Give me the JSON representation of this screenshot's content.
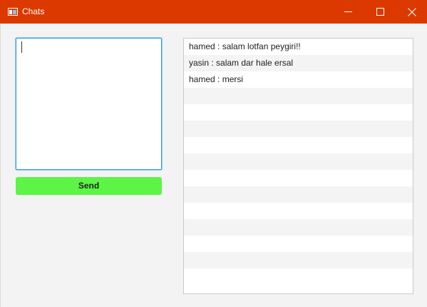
{
  "window": {
    "title": "Chats",
    "accent_color": "#dc3900",
    "icons": {
      "app": "window-app-icon",
      "minimize": "minimize-icon",
      "maximize": "maximize-icon",
      "close": "close-icon"
    }
  },
  "compose": {
    "input_value": "",
    "send_label": "Send",
    "send_color": "#5cf545"
  },
  "chat": {
    "messages": [
      "hamed : salam lotfan peygiri!!",
      "yasin : salam dar hale ersal",
      "hamed : mersi",
      "",
      "",
      "",
      "",
      "",
      "",
      "",
      "",
      "",
      "",
      "",
      ""
    ]
  }
}
